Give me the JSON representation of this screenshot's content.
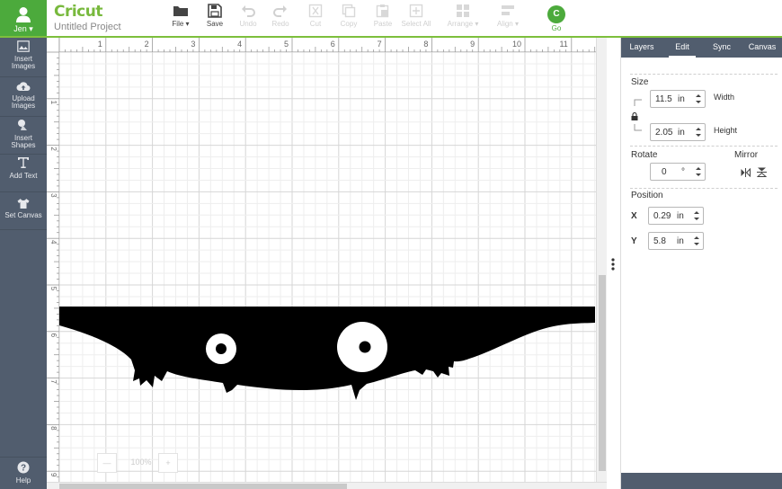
{
  "user": {
    "name": "Jen"
  },
  "brand": {
    "logo": "Cricut",
    "project_title": "Untitled Project"
  },
  "toolbar": {
    "file": "File",
    "save": "Save",
    "undo": "Undo",
    "redo": "Redo",
    "cut": "Cut",
    "copy": "Copy",
    "paste": "Paste",
    "select_all": "Select All",
    "arrange": "Arrange",
    "align": "Align",
    "go": "Go",
    "go_icon": "C"
  },
  "sidebar": {
    "items": [
      {
        "label": "Insert Images",
        "icon": "image-icon"
      },
      {
        "label": "Upload Images",
        "icon": "cloud-upload-icon"
      },
      {
        "label": "Insert Shapes",
        "icon": "shapes-icon"
      },
      {
        "label": "Add Text",
        "icon": "text-icon"
      },
      {
        "label": "Set Canvas",
        "icon": "shirt-icon"
      }
    ],
    "help": "Help"
  },
  "canvas": {
    "ruler_top": [
      "1",
      "2",
      "3",
      "4",
      "5",
      "6",
      "7",
      "8",
      "9",
      "10",
      "11"
    ],
    "ruler_left": [
      "1",
      "2",
      "3",
      "4",
      "5",
      "6",
      "7",
      "8",
      "9"
    ],
    "zoom_level": "100%"
  },
  "panel": {
    "tabs": [
      "Layers",
      "Edit",
      "Sync",
      "Canvas"
    ],
    "active_tab": "Edit",
    "size": {
      "title": "Size",
      "width_value": "11.5",
      "height_value": "2.05",
      "unit": "in",
      "width_label": "Width",
      "height_label": "Height"
    },
    "rotate": {
      "title": "Rotate",
      "value": "0",
      "unit": "°"
    },
    "mirror": {
      "title": "Mirror"
    },
    "position": {
      "title": "Position",
      "x_label": "X",
      "x_value": "0.29",
      "y_label": "Y",
      "y_value": "5.8",
      "unit": "in"
    }
  },
  "colors": {
    "brand_green": "#4caa3c",
    "sidebar": "#515d6e",
    "shape_fill": "#000000"
  }
}
